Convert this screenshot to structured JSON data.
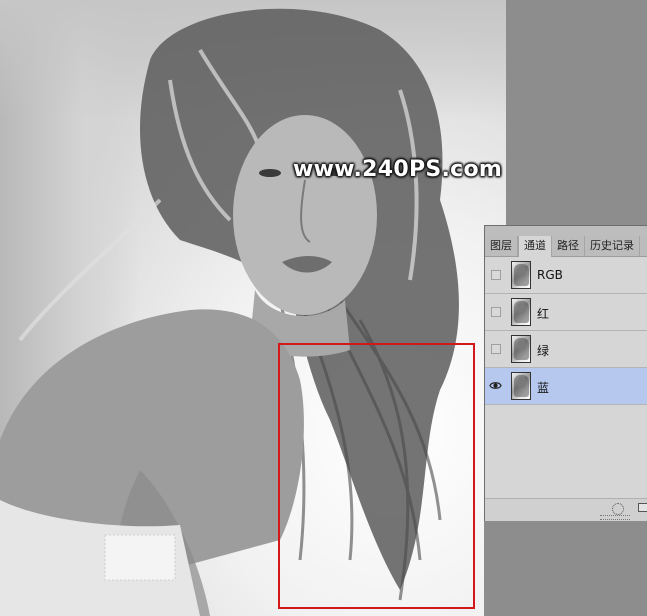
{
  "watermark": "www.240PS.com",
  "canvas_image": "black-and-white-portrait-woman-curly-hair",
  "channels_panel": {
    "tabs": [
      {
        "label": "图层",
        "active": false
      },
      {
        "label": "通道",
        "active": true
      },
      {
        "label": "路径",
        "active": false
      },
      {
        "label": "历史记录",
        "active": false
      }
    ],
    "channels": [
      {
        "label": "RGB",
        "visible": false,
        "selected": false
      },
      {
        "label": "红",
        "visible": false,
        "selected": false
      },
      {
        "label": "绿",
        "visible": false,
        "selected": false
      },
      {
        "label": "蓝",
        "visible": true,
        "selected": true
      }
    ],
    "icons": {
      "load_selection": "dotted-circle-icon",
      "save_selection": "save-selection-icon",
      "visibility": "eye-icon"
    }
  },
  "colors": {
    "selection_rect": "#d21818",
    "selected_row": "#b6c8ee"
  }
}
